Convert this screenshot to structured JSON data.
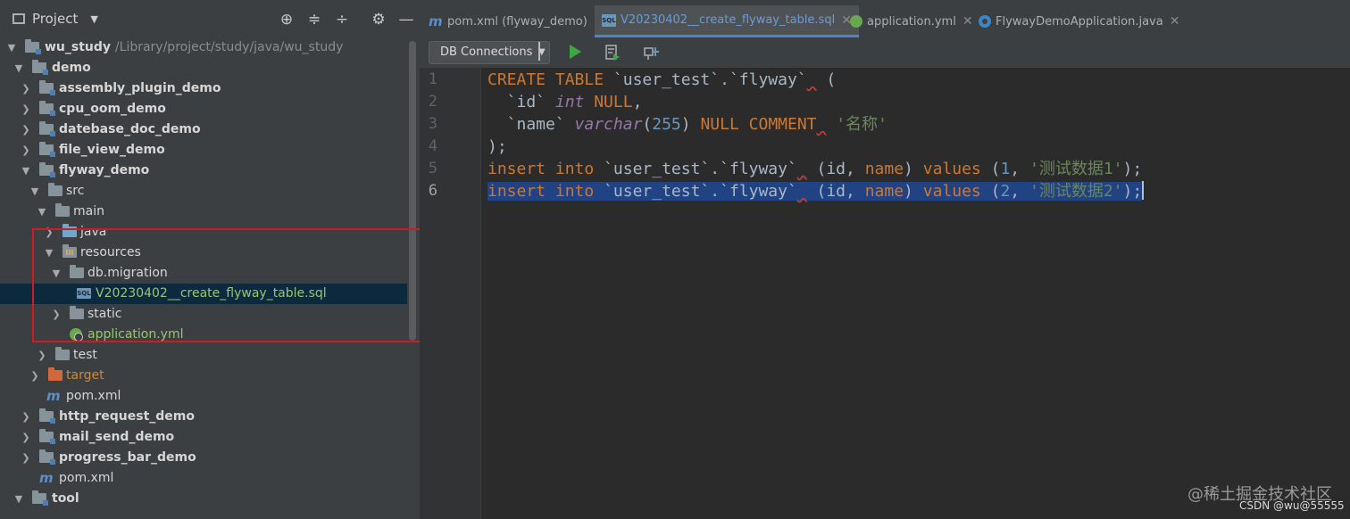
{
  "project_panel": {
    "title": "Project",
    "dropdown_icon": "chevron-down-icon",
    "actions": [
      "locate-icon",
      "expand-all-icon",
      "collapse-all-icon",
      "gear-icon",
      "minimize-icon"
    ]
  },
  "tree": {
    "items": [
      {
        "label": "wu_study",
        "path": "/Library/project/study/java/wu_study"
      },
      {
        "label": "demo"
      },
      {
        "label": "assembly_plugin_demo"
      },
      {
        "label": "cpu_oom_demo"
      },
      {
        "label": "datebase_doc_demo"
      },
      {
        "label": "file_view_demo"
      },
      {
        "label": "flyway_demo"
      },
      {
        "label": "src"
      },
      {
        "label": "main"
      },
      {
        "label": "java"
      },
      {
        "label": "resources"
      },
      {
        "label": "db.migration"
      },
      {
        "label": "V20230402__create_flyway_table.sql"
      },
      {
        "label": "static"
      },
      {
        "label": "application.yml"
      },
      {
        "label": "test"
      },
      {
        "label": "target"
      },
      {
        "label": "pom.xml"
      },
      {
        "label": "http_request_demo"
      },
      {
        "label": "mail_send_demo"
      },
      {
        "label": "progress_bar_demo"
      },
      {
        "label": "pom.xml"
      },
      {
        "label": "tool"
      }
    ]
  },
  "tabs": [
    {
      "label": "pom.xml (flyway_demo)",
      "icon": "maven-icon"
    },
    {
      "label": "V20230402__create_flyway_table.sql",
      "icon": "sql-file-icon",
      "active": true
    },
    {
      "label": "application.yml",
      "icon": "spring-yml-icon"
    },
    {
      "label": "FlywayDemoApplication.java",
      "icon": "java-class-icon"
    }
  ],
  "toolbar": {
    "db_connections": "DB Connections",
    "icons": [
      "run-icon",
      "explain-plan-icon",
      "settings-icon"
    ]
  },
  "editor": {
    "line_numbers": [
      "1",
      "2",
      "3",
      "4",
      "5",
      "6"
    ],
    "current_line": "6",
    "lines": [
      [
        [
          "kw",
          "CREATE"
        ],
        [
          "id",
          " "
        ],
        [
          "kw",
          "TABLE"
        ],
        [
          "id",
          " `user_test`.`flyway`"
        ],
        [
          "id",
          " ("
        ]
      ],
      [
        [
          "id",
          "  `id` "
        ],
        [
          "ty",
          "int"
        ],
        [
          "kw",
          " NULL"
        ],
        [
          "id",
          ","
        ]
      ],
      [
        [
          "id",
          "  `name` "
        ],
        [
          "ty",
          "varchar"
        ],
        [
          "id",
          "("
        ],
        [
          "num",
          "255"
        ],
        [
          "id",
          ") "
        ],
        [
          "kw",
          "NULL"
        ],
        [
          "id",
          " "
        ],
        [
          "kw",
          "COMMENT"
        ],
        [
          "id",
          " "
        ],
        [
          "str",
          "'名称'"
        ]
      ],
      [
        [
          "id",
          ");"
        ]
      ],
      [
        [
          "kw",
          "insert"
        ],
        [
          "id",
          " "
        ],
        [
          "kw",
          "into"
        ],
        [
          "id",
          " `user_test`.`flyway`"
        ],
        [
          "id",
          " (id, "
        ],
        [
          "kw",
          "name"
        ],
        [
          "id",
          ") "
        ],
        [
          "kw",
          "values"
        ],
        [
          "id",
          " ("
        ],
        [
          "num",
          "1"
        ],
        [
          "id",
          ", "
        ],
        [
          "str",
          "'测试数据1'"
        ],
        [
          "id",
          ");"
        ]
      ],
      [
        [
          "kw",
          "insert"
        ],
        [
          "id",
          " "
        ],
        [
          "kw",
          "into"
        ],
        [
          "id",
          " `user_test`.`flyway`"
        ],
        [
          "id",
          " (id, "
        ],
        [
          "kw",
          "name"
        ],
        [
          "id",
          ") "
        ],
        [
          "kw",
          "values"
        ],
        [
          "id",
          " ("
        ],
        [
          "num",
          "2"
        ],
        [
          "id",
          ", "
        ],
        [
          "str",
          "'测试数据2'"
        ],
        [
          "id",
          ");"
        ]
      ]
    ]
  },
  "watermark": "@稀土掘金技术社区",
  "csdn_mark": "CSDN @wu@55555",
  "colors": {
    "keyword": "#cc7832",
    "string": "#6a8759",
    "number": "#6897bb",
    "type": "#9876aa",
    "selection": "#214283",
    "annotation_box": "#d01a24"
  }
}
